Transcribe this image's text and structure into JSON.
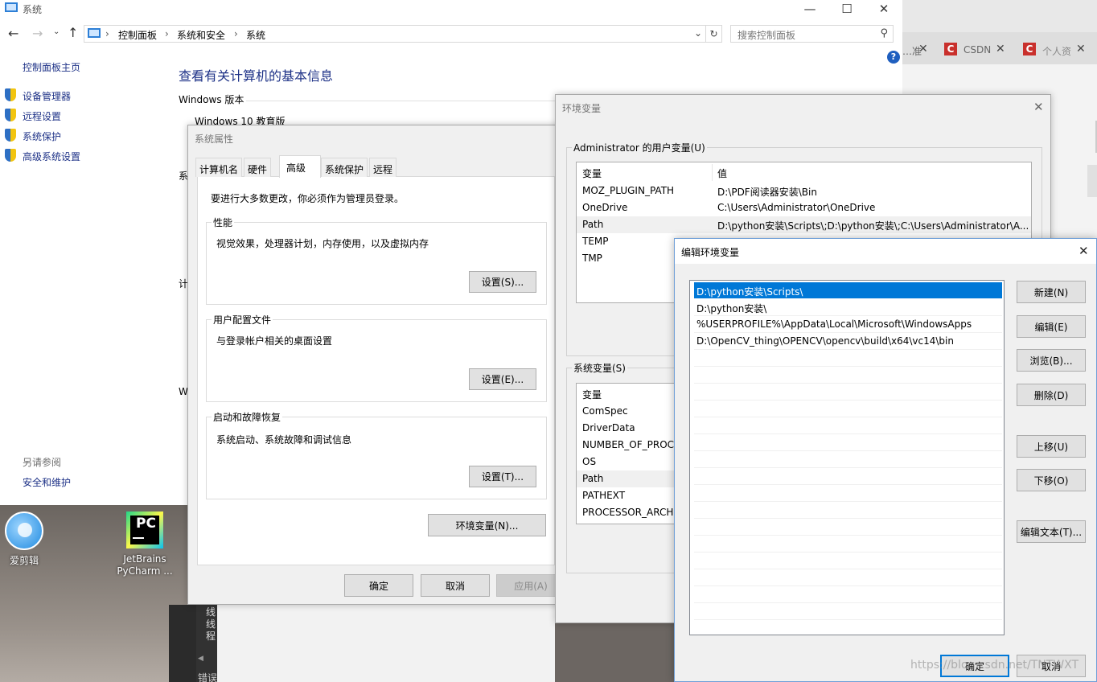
{
  "system_window": {
    "title": "系统",
    "breadcrumbs": [
      "控制面板",
      "系统和安全",
      "系统"
    ],
    "search_placeholder": "搜索控制面板",
    "sidebar_home": "控制面板主页",
    "sidebar_links": [
      "设备管理器",
      "远程设置",
      "系统保护",
      "高级系统设置"
    ],
    "see_also_heading": "另请参阅",
    "see_also_link": "安全和维护",
    "heading": "查看有关计算机的基本信息",
    "windows_version_label": "Windows 版本",
    "windows_edition": "Windows 10 教育版",
    "partial_labels": [
      "系",
      "计",
      "W"
    ]
  },
  "browser_tabs": [
    {
      "title": "…准",
      "icon": "none"
    },
    {
      "title": "CSDN",
      "icon": "csdn-icon"
    },
    {
      "title": "个人资",
      "icon": "csdn-icon"
    }
  ],
  "sys_props": {
    "title": "系统属性",
    "tabs": [
      "计算机名",
      "硬件",
      "高级",
      "系统保护",
      "远程"
    ],
    "active_tab": "高级",
    "admin_note": "要进行大多数更改，你必须作为管理员登录。",
    "perf_title": "性能",
    "perf_desc": "视觉效果，处理器计划，内存使用，以及虚拟内存",
    "perf_btn": "设置(S)...",
    "profile_title": "用户配置文件",
    "profile_desc": "与登录帐户相关的桌面设置",
    "profile_btn": "设置(E)...",
    "startup_title": "启动和故障恢复",
    "startup_desc": "系统启动、系统故障和调试信息",
    "startup_btn": "设置(T)...",
    "env_btn": "环境变量(N)...",
    "ok": "确定",
    "cancel": "取消",
    "apply": "应用(A)"
  },
  "env_vars": {
    "title": "环境变量",
    "user_section": "Administrator 的用户变量(U)",
    "col_var": "变量",
    "col_val": "值",
    "user_rows": [
      {
        "name": "MOZ_PLUGIN_PATH",
        "value": "D:\\PDF阅读器安装\\Bin"
      },
      {
        "name": "OneDrive",
        "value": "C:\\Users\\Administrator\\OneDrive"
      },
      {
        "name": "Path",
        "value": "D:\\python安装\\Scripts\\;D:\\python安装\\;C:\\Users\\Administrator\\A..."
      },
      {
        "name": "TEMP",
        "value": ""
      },
      {
        "name": "TMP",
        "value": ""
      }
    ],
    "sys_section": "系统变量(S)",
    "sys_rows": [
      "ComSpec",
      "DriverData",
      "NUMBER_OF_PROC",
      "OS",
      "Path",
      "PATHEXT",
      "PROCESSOR_ARCHI"
    ]
  },
  "edit_env": {
    "title": "编辑环境变量",
    "entries": [
      "D:\\python安装\\Scripts\\",
      "D:\\python安装\\",
      "%USERPROFILE%\\AppData\\Local\\Microsoft\\WindowsApps",
      "D:\\OpenCV_thing\\OPENCV\\opencv\\build\\x64\\vc14\\bin"
    ],
    "buttons": {
      "new": "新建(N)",
      "edit": "编辑(E)",
      "browse": "浏览(B)...",
      "delete": "删除(D)",
      "up": "上移(U)",
      "down": "下移(O)",
      "edit_text": "编辑文本(T)..."
    },
    "ok": "确定",
    "cancel": "取消"
  },
  "desktop": {
    "icons": [
      {
        "label": "爱剪辑",
        "icon": "aijianji-icon"
      },
      {
        "label": "JetBrains PyCharm ...",
        "icon": "pycharm-icon"
      }
    ],
    "console_chars": [
      "线",
      "线",
      "程"
    ],
    "error_label": "错误"
  },
  "watermark": "https://blog.csdn.net/TNTWXT",
  "colors": {
    "accent": "#0078d7",
    "heading_blue": "#1e3287",
    "csdn_red": "#c9302c",
    "help_blue": "#1f5fbf",
    "shield_blue": "#2d6fc4",
    "shield_yellow": "#f2c40f"
  }
}
